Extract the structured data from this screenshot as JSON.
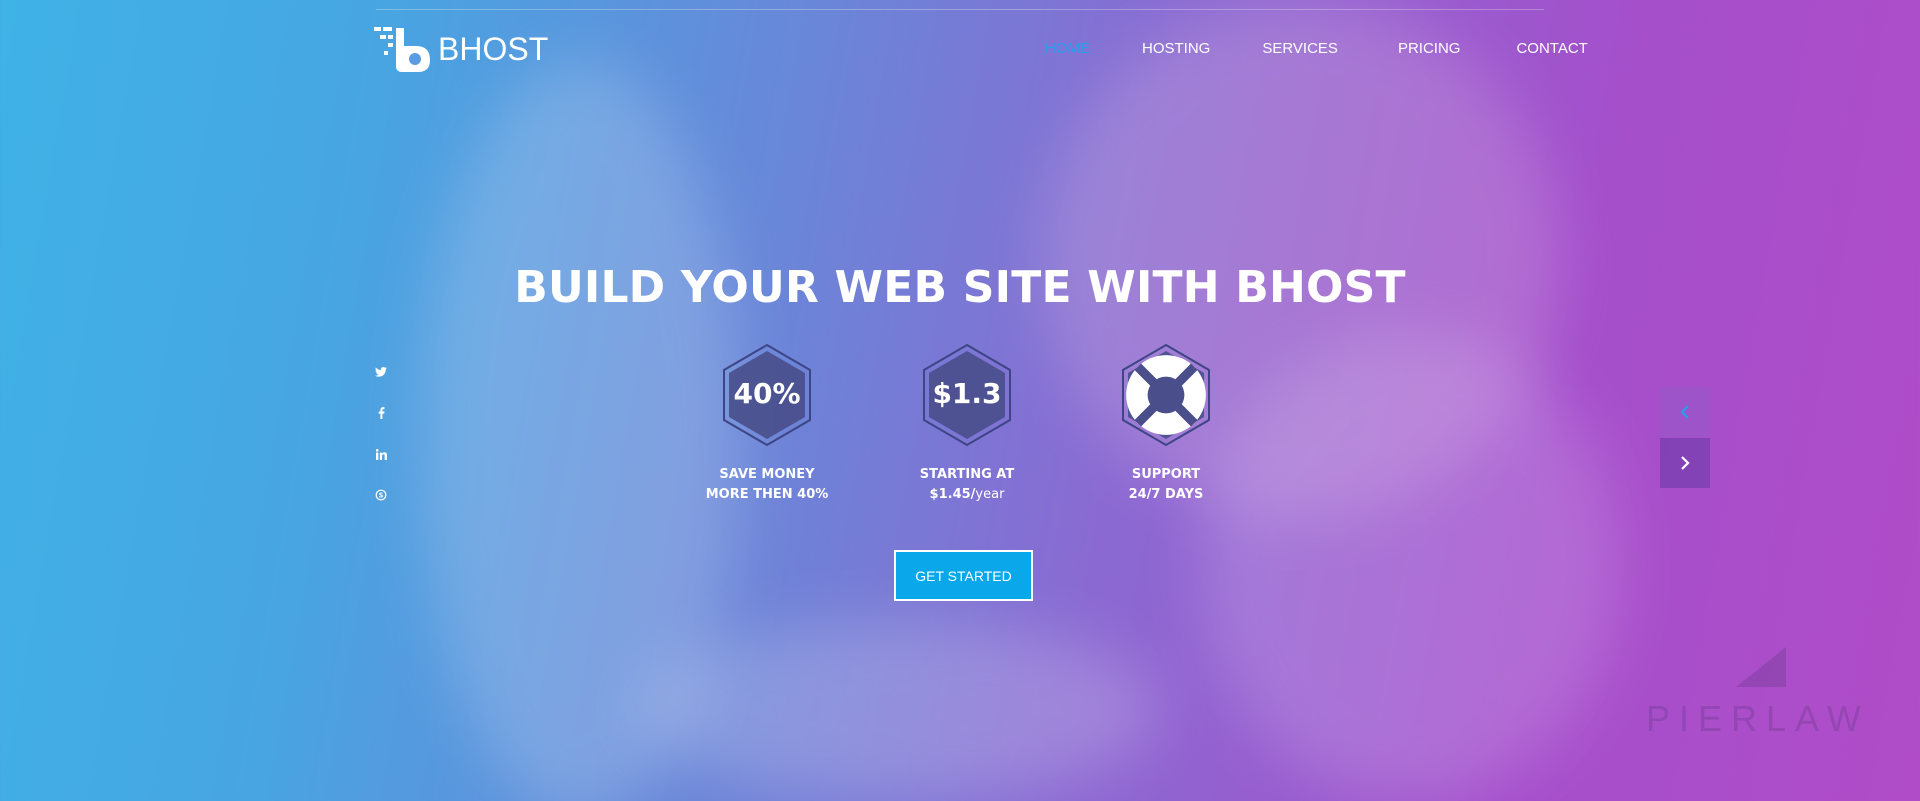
{
  "brand": {
    "name": "BHOST"
  },
  "nav": {
    "items": [
      {
        "label": "HOME",
        "active": true
      },
      {
        "label": "HOSTING",
        "active": false
      },
      {
        "label": "SERVICES",
        "active": false
      },
      {
        "label": "PRICING",
        "active": false
      },
      {
        "label": "CONTACT",
        "active": false
      }
    ]
  },
  "social": [
    "twitter-icon",
    "facebook-icon",
    "linkedin-icon",
    "skype-icon"
  ],
  "hero": {
    "title": "BUILD YOUR WEB SITE WITH BHOST",
    "features": [
      {
        "value": "40%",
        "line1": "SAVE MONEY",
        "line2": "MORE THEN 40%"
      },
      {
        "value": "$1.3",
        "line1": "STARTING AT",
        "line2_strong": "$1.45/",
        "line2_small": "year"
      },
      {
        "icon": "lifebuoy-icon",
        "line1": "SUPPORT",
        "line2": "24/7 DAYS"
      }
    ],
    "cta_label": "GET STARTED"
  },
  "watermark": {
    "text": "PIERLAW"
  },
  "colors": {
    "accent": "#0aa7ea",
    "nav_active": "#1ea3ee",
    "gradient_start": "#3fb2e6",
    "gradient_end": "#b04cc8",
    "hex_fill": "#4a4f8c"
  }
}
